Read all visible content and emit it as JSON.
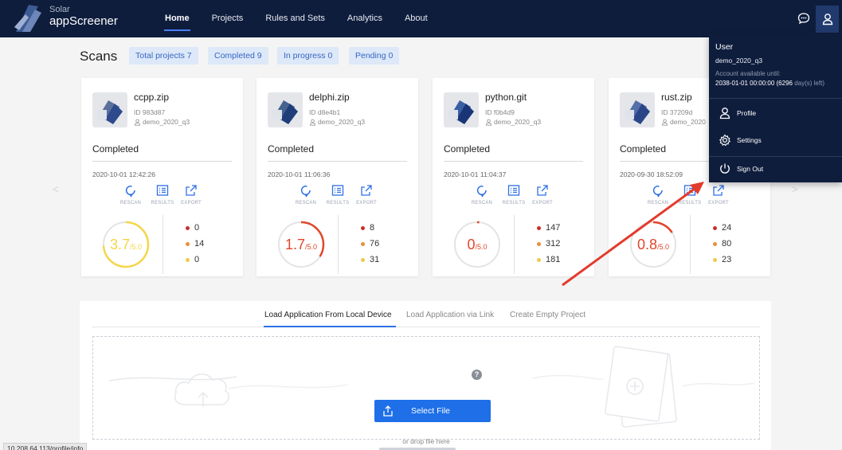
{
  "header": {
    "brand_top": "Solar",
    "brand_bottom": "appScreener",
    "nav": [
      "Home",
      "Projects",
      "Rules and Sets",
      "Analytics",
      "About"
    ]
  },
  "summary": {
    "title": "Scans",
    "chips": [
      "Total projects 7",
      "Completed 9",
      "In progress 0",
      "Pending 0"
    ]
  },
  "actions": {
    "rescan": "RESCAN",
    "results": "RESULTS",
    "export": "EXPORT"
  },
  "cards": [
    {
      "name": "ccpp.zip",
      "id": "ID 983d87",
      "user": "demo_2020_q3",
      "status": "Completed",
      "date": "2020-10-01 12:42:26",
      "score": "3.7",
      "max": "/5.0",
      "score_value": 3.7,
      "counts": [
        "0",
        "14",
        "0"
      ]
    },
    {
      "name": "delphi.zip",
      "id": "ID d8e4b1",
      "user": "demo_2020_q3",
      "status": "Completed",
      "date": "2020-10-01 11:06:36",
      "score": "1.7",
      "max": "/5.0",
      "score_value": 1.7,
      "counts": [
        "8",
        "76",
        "31"
      ]
    },
    {
      "name": "python.git",
      "id": "ID f0b4d9",
      "user": "demo_2020_q3",
      "status": "Completed",
      "date": "2020-10-01 11:04:37",
      "score": "0",
      "max": "/5.0",
      "score_value": 0,
      "counts": [
        "147",
        "312",
        "181"
      ]
    },
    {
      "name": "rust.zip",
      "id": "ID 37209d",
      "user": "demo_2020",
      "status": "Completed",
      "date": "2020-09-30 18:52:09",
      "score": "0.8",
      "max": "/5.0",
      "score_value": 0.8,
      "counts": [
        "24",
        "80",
        "23"
      ]
    }
  ],
  "colors": {
    "high": "#c9302c",
    "medium": "#e8903a",
    "low": "#f2c94c",
    "accent": "#1e6fe8",
    "gauge_good": "#f5d54a",
    "gauge_bad": "#e0462b"
  },
  "upload": {
    "tabs": [
      "Load Application From Local Device",
      "Load Application via Link",
      "Create Empty Project"
    ],
    "select_file": "Select File",
    "drop_text": "or drop file here",
    "help": "?"
  },
  "user_menu": {
    "title": "User",
    "username": "demo_2020_q3",
    "available_label": "Account available until:",
    "available_date": "2038-01-01 00:00:00 (6296",
    "available_suffix": "day(s) left)",
    "items": [
      "Profile",
      "Settings",
      "Sign Out"
    ]
  },
  "status_url": "10.208.64.113/profile/info"
}
